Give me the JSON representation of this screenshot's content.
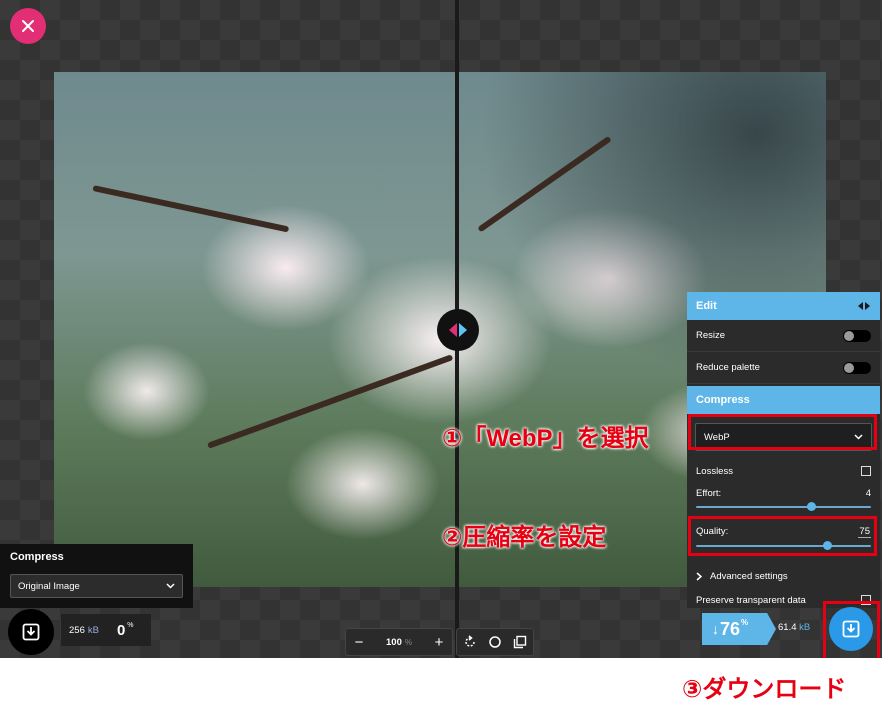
{
  "right_panel": {
    "edit_header": "Edit",
    "resize_label": "Resize",
    "reduce_palette_label": "Reduce palette",
    "compress_header": "Compress",
    "format_selected": "WebP",
    "lossless_label": "Lossless",
    "effort_label": "Effort:",
    "effort_value": "4",
    "effort_fraction": 0.66,
    "quality_label": "Quality:",
    "quality_value": "75",
    "quality_fraction": 0.75,
    "advanced_label": "Advanced settings",
    "preserve_label": "Preserve transparent data"
  },
  "result": {
    "arrow": "↓",
    "savings_number": "76",
    "savings_unit": "%",
    "size_value": "61.4",
    "size_unit": "kB"
  },
  "left_panel": {
    "header": "Compress",
    "format_selected": "Original Image",
    "size_value": "256",
    "size_unit": "kB",
    "percent_value": "0",
    "percent_unit": "%"
  },
  "toolbar": {
    "zoom_out": "−",
    "zoom_value": "100",
    "zoom_unit": "%",
    "zoom_in": "+"
  },
  "annotations": {
    "step1": "①「WebP」を選択",
    "step2": "②圧縮率を設定",
    "step3": "③ダウンロード"
  },
  "colors": {
    "accent_blue": "#5eb5e8",
    "accent_pink": "#e22e74",
    "annotation_red": "#e60012"
  },
  "icons": {
    "close": "close-icon",
    "download": "download-icon",
    "rotate": "rotate-icon",
    "circle": "background-toggle-icon",
    "compare": "side-by-side-icon"
  }
}
